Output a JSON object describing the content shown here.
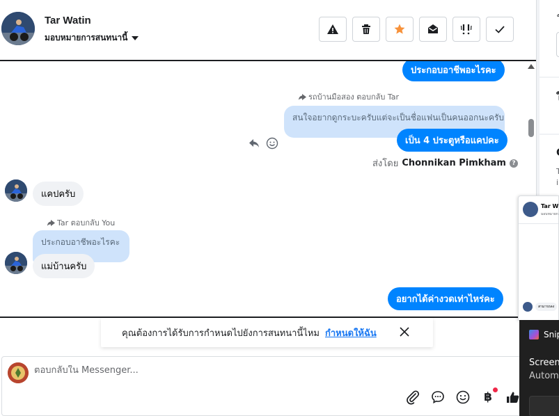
{
  "header": {
    "contact_name": "Tar Watin",
    "assign_label": "มอบหมายการสนทนานี้",
    "tools": [
      {
        "name": "warning-icon"
      },
      {
        "name": "trash-icon"
      },
      {
        "name": "star-icon",
        "color": "#f7923b"
      },
      {
        "name": "envelope-open-icon"
      },
      {
        "name": "follow-up-icon"
      },
      {
        "name": "check-icon"
      }
    ]
  },
  "thread": {
    "messages": {
      "out_top": "ประกอบอาชีพอะไรคะ",
      "reply_meta_1": "รถบ้านมือสอง ตอบกลับ Tar",
      "quote_1": "สนใจอยากดูกระบะครับแต่จะเป็นชื่อแฟนเป็นคนออกนะครับ",
      "out_2": "เป็น 4 ประตูหรือแคปคะ",
      "sent_by_prefix": "ส่งโดย",
      "sent_by_name": "Chonnikan Pimkham",
      "help_label": "?",
      "in_1": "แคปครับ",
      "reply_meta_2": "Tar ตอบกลับ You",
      "quote_2": "ประกอบอาชีพอะไรคะ",
      "in_2": "แม่บ้านครับ",
      "out_3": "อยากได้ค่างวดเท่าไหร่คะ"
    },
    "accent_color": "#0084ff"
  },
  "suggestion": {
    "text": "คุณต้องการได้รับการกำหนดไปยังการสนทนานี้ไหม",
    "link": "กำหนดให้ฉัน"
  },
  "composer": {
    "placeholder": "ตอบกลับใน Messenger...",
    "value": "",
    "currency_symbol": "฿",
    "tools": [
      "paperclip-icon",
      "chat-bubble-icon",
      "emoji-icon",
      "currency-icon",
      "thumbs-up-icon"
    ]
  },
  "right_panel": {
    "char_1": "ใ",
    "char_2": "ใ",
    "char_3": "C",
    "char_4": "T",
    "char_5": "in"
  },
  "mini_chat": {
    "name": "Tar Watin",
    "sub": "มอบหมายการ",
    "row_text": "สามารถลง"
  },
  "snip": {
    "title": "Snip",
    "line1": "Screen",
    "line2": "Autom"
  }
}
